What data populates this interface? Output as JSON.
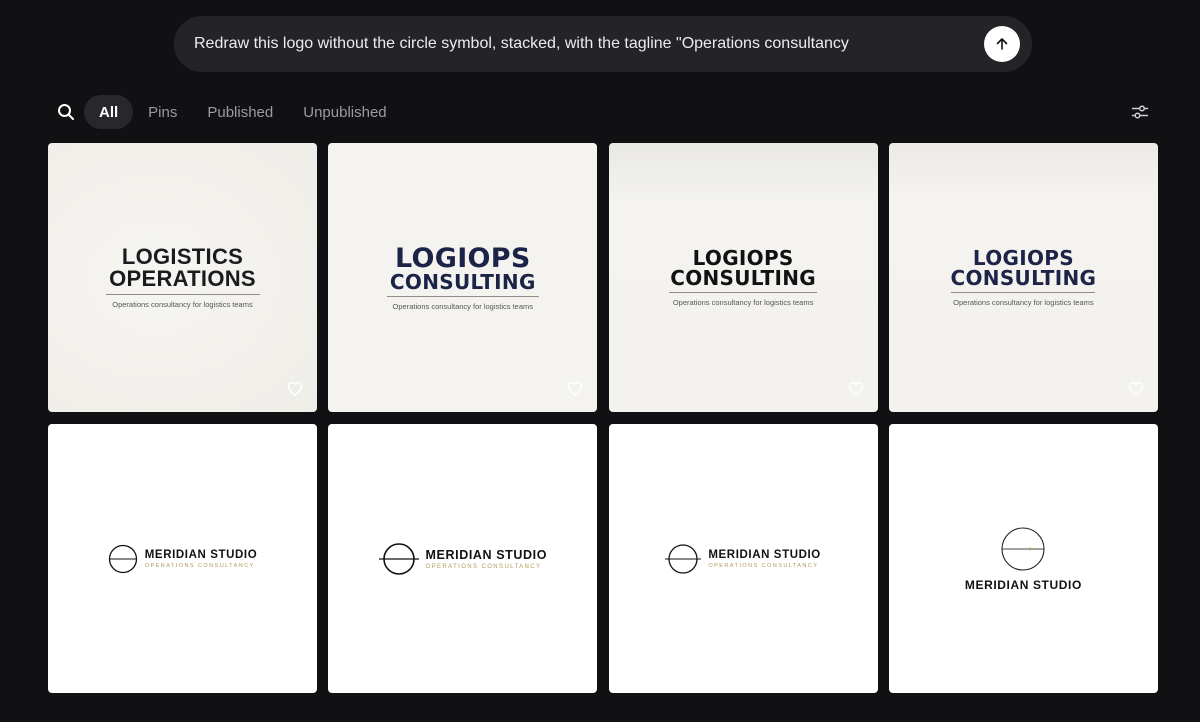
{
  "prompt": {
    "text": "Redraw this logo without the circle symbol, stacked, with the tagline \"Operations consultancy",
    "submit_icon": "arrow-up-icon"
  },
  "filters": {
    "search_icon": "search-icon",
    "tabs": [
      {
        "label": "All",
        "active": true
      },
      {
        "label": "Pins",
        "active": false
      },
      {
        "label": "Published",
        "active": false
      },
      {
        "label": "Unpublished",
        "active": false
      }
    ],
    "settings_icon": "sliders-icon"
  },
  "gallery": {
    "row1": [
      {
        "line1": "LOGISTICS",
        "line2": "OPERATIONS",
        "tagline": "Operations consultancy for logistics teams",
        "heart_icon": "heart-icon"
      },
      {
        "line1": "LOGIOPS",
        "line2": "CONSULTING",
        "tagline": "Operations consultancy for logistics teams",
        "heart_icon": "heart-icon"
      },
      {
        "line1": "LOGIOPS",
        "line2": "CONSULTING",
        "tagline": "Operations consultancy for logistics teams",
        "heart_icon": "heart-icon"
      },
      {
        "line1": "LOGIOPS",
        "line2": "CONSULTING",
        "tagline": "Operations consultancy for logistics teams",
        "heart_icon": "heart-icon"
      }
    ],
    "row2": [
      {
        "name": "MERIDIAN STUDIO",
        "tagline": "OPERATIONS CONSULTANCY"
      },
      {
        "name": "MERIDIAN STUDIO",
        "tagline": "OPERATIONS CONSULTANCY"
      },
      {
        "name": "MERIDIAN STUDIO",
        "tagline": "OPERATIONS CONSULTANCY"
      },
      {
        "name": "MERIDIAN STUDIO"
      }
    ]
  },
  "colors": {
    "background": "#111012",
    "prompt_bar": "#242327",
    "navy": "#1b2447",
    "gold": "#b39a5c"
  }
}
